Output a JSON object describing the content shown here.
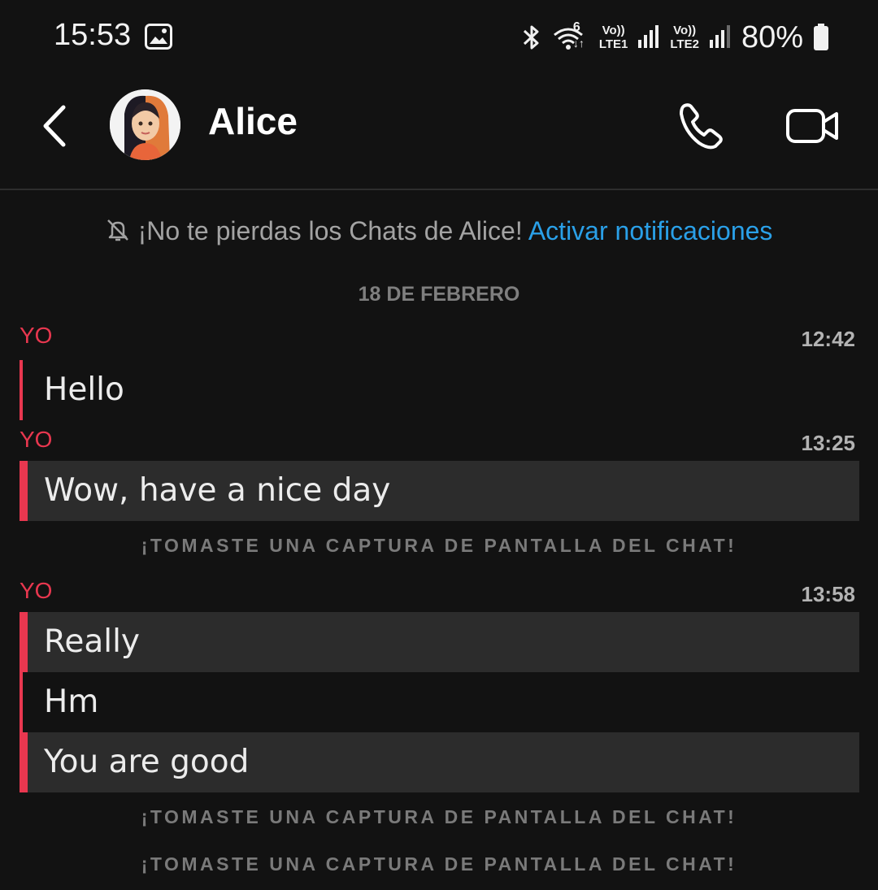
{
  "status_bar": {
    "time": "15:53",
    "network_badge": "6",
    "sim1_top": "Vo))",
    "sim1_bottom": "LTE1",
    "sim2_top": "Vo))",
    "sim2_bottom": "LTE2",
    "battery": "80%",
    "icons": [
      "gallery-icon",
      "bluetooth-icon",
      "wifi-icon",
      "signal-icon",
      "battery-icon"
    ]
  },
  "header": {
    "contact_name": "Alice",
    "icons": [
      "back-icon",
      "avatar",
      "phone-icon",
      "video-icon"
    ]
  },
  "notification": {
    "text": "¡No te pierdas los Chats de Alice!",
    "link": "Activar notificaciones",
    "icon": "bell-off-icon"
  },
  "date_separator": "18 DE FEBRERO",
  "messages": [
    {
      "sender": "YO",
      "time": "12:42",
      "lines": [
        "Hello"
      ]
    },
    {
      "sender": "YO",
      "time": "13:25",
      "lines": [
        "Wow, have a nice day"
      ]
    },
    {
      "sender": "YO",
      "time": "13:58",
      "lines": [
        "Really",
        "Hm",
        "You are good"
      ]
    }
  ],
  "system_notes": [
    "¡TOMASTE UNA CAPTURA DE PANTALLA DEL CHAT!",
    "¡TOMASTE UNA CAPTURA DE PANTALLA DEL CHAT!",
    "¡TOMASTE UNA CAPTURA DE PANTALLA DEL CHAT!"
  ],
  "colors": {
    "background": "#121212",
    "accent_red": "#e8374f",
    "link_blue": "#2aa0e8",
    "highlight_bg": "#2c2c2c"
  }
}
